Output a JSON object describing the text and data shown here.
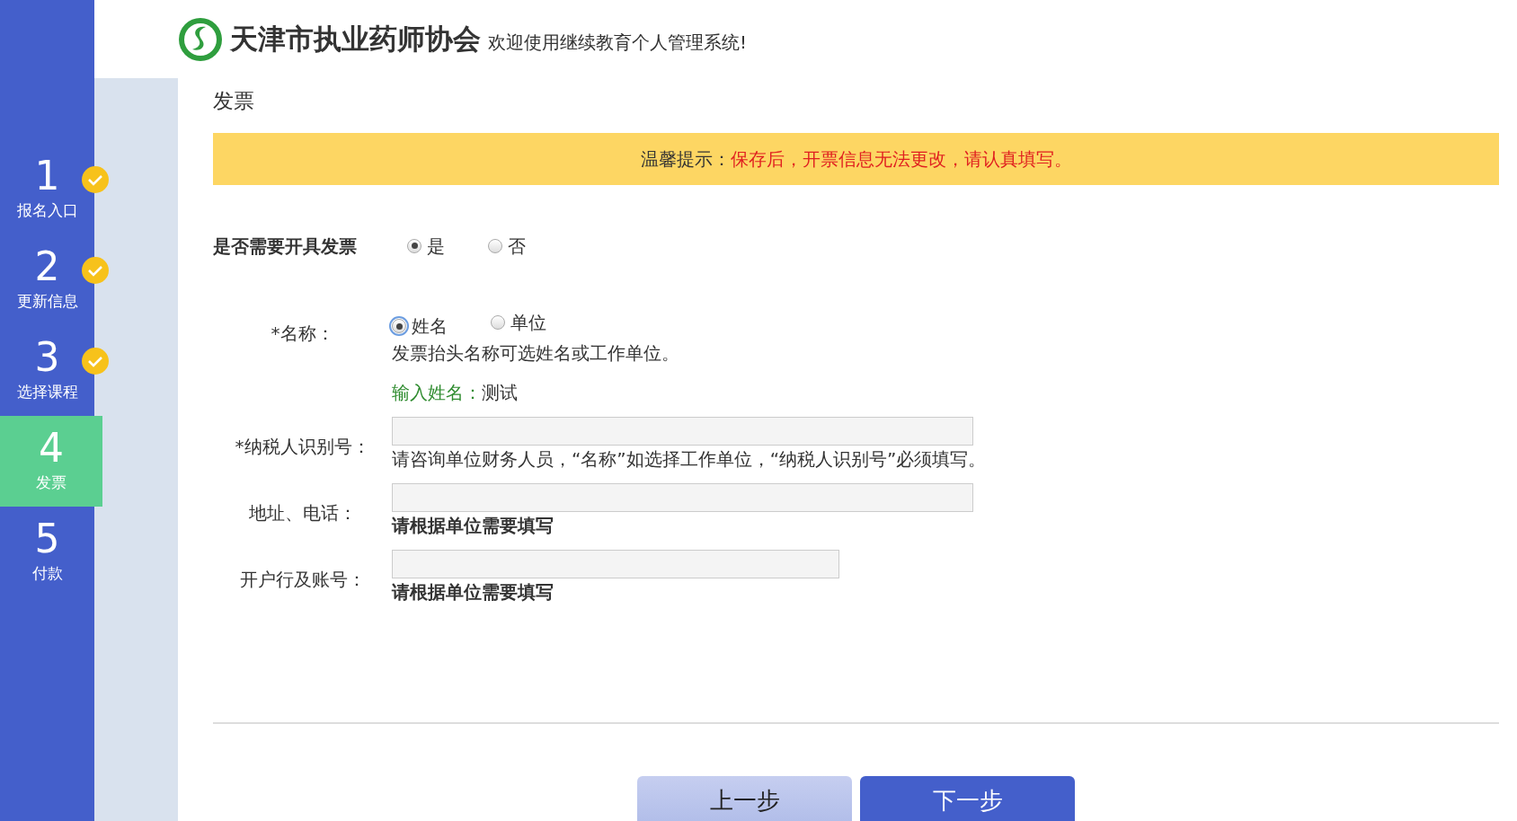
{
  "header": {
    "org_name": "天津市执业药师协会",
    "welcome": "欢迎使用继续教育个人管理系统!"
  },
  "steps": [
    {
      "number": "1",
      "label": "报名入口",
      "done": true,
      "selected": false
    },
    {
      "number": "2",
      "label": "更新信息",
      "done": true,
      "selected": false
    },
    {
      "number": "3",
      "label": "选择课程",
      "done": true,
      "selected": false
    },
    {
      "number": "4",
      "label": "发票",
      "done": false,
      "selected": true
    },
    {
      "number": "5",
      "label": "付款",
      "done": false,
      "selected": false
    }
  ],
  "page_title": "发票",
  "notice": {
    "label": "温馨提示：",
    "message": "保存后，开票信息无法更改，请认真填写。"
  },
  "invoice_required": {
    "label": "是否需要开具发票",
    "options": [
      {
        "label": "是",
        "selected": true
      },
      {
        "label": "否",
        "selected": false
      }
    ]
  },
  "fields": [
    {
      "kind": "radio",
      "label": "*名称：",
      "options": [
        {
          "label": "姓名",
          "selected": true,
          "focused": true
        },
        {
          "label": "单位",
          "selected": false,
          "focused": false
        }
      ],
      "help": "发票抬头名称可选姓名或工作单位。",
      "help_bold": false,
      "sub_label": "输入姓名：",
      "sub_value": "测试"
    },
    {
      "kind": "input",
      "label": "*纳税人识别号：",
      "help": "请咨询单位财务人员，“名称”如选择工作单位，“纳税人识别号”必须填写。",
      "help_bold": false
    },
    {
      "kind": "input",
      "label": "地址、电话：",
      "help": "请根据单位需要填写",
      "help_bold": true
    },
    {
      "kind": "short_input",
      "label": "开户行及账号：",
      "help": "请根据单位需要填写",
      "help_bold": true
    }
  ],
  "buttons": [
    {
      "label": "上一步",
      "kind": "secondary"
    },
    {
      "label": "下一步",
      "kind": "primary"
    }
  ]
}
